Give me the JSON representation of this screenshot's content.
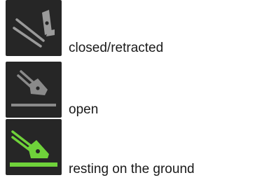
{
  "legend": {
    "items": [
      {
        "state": "closed",
        "label": "closed/retracted",
        "icon": "leg-closed-icon",
        "icon_color": "#9a9a9a"
      },
      {
        "state": "open",
        "label": "open",
        "icon": "leg-open-icon",
        "icon_color": "#8a8a8a"
      },
      {
        "state": "ground",
        "label": "resting on the ground",
        "icon": "leg-ground-icon",
        "icon_color": "#6fd23a"
      }
    ]
  },
  "colors": {
    "tile_background": "#262626",
    "inactive_icon": "#9a9a9a",
    "active_icon": "#6fd23a",
    "text": "#1a1a1a",
    "page_background": "#ffffff"
  }
}
